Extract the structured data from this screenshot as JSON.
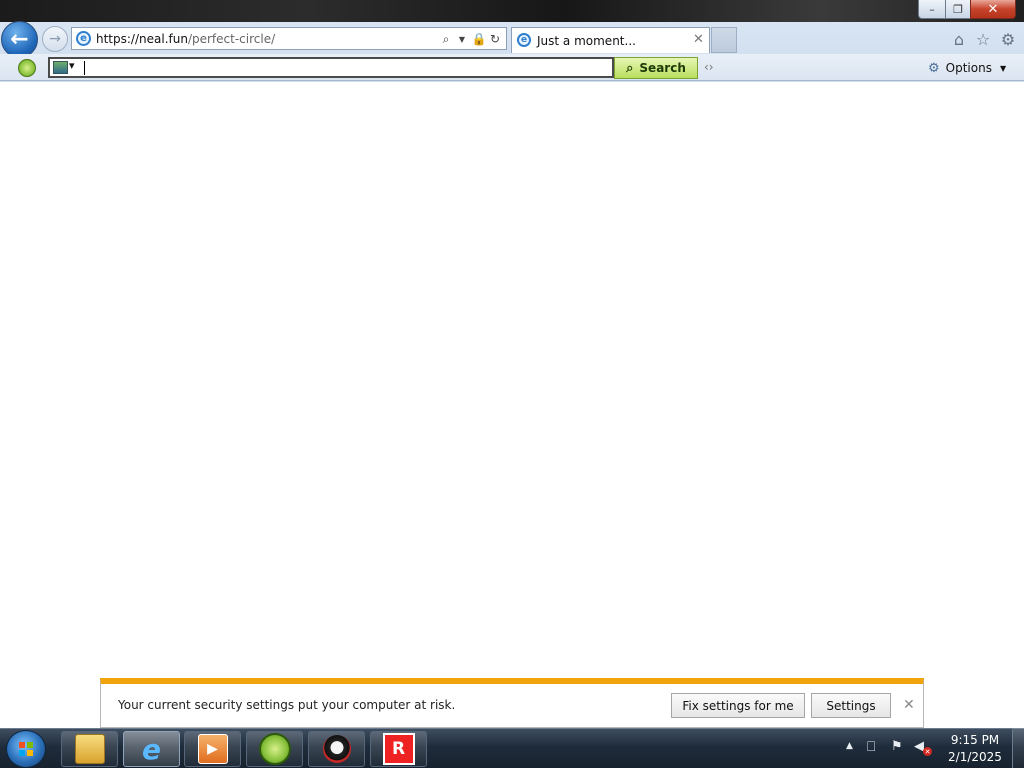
{
  "window": {
    "minimize_glyph": "–",
    "maximize_glyph": "❐",
    "close_glyph": "✕"
  },
  "nav": {
    "back_glyph": "←",
    "forward_glyph": "→"
  },
  "address_bar": {
    "url_host": "https://neal.fun",
    "url_path": "/perfect-circle/",
    "page_icon": "ie-icon",
    "tools": [
      "search-icon",
      "dropdown-icon",
      "lock-icon",
      "refresh-icon"
    ]
  },
  "tabs": [
    {
      "title": "Just a moment...",
      "icon": "ie-icon",
      "active": true
    }
  ],
  "command_icons": [
    "home-icon",
    "favorites-icon",
    "tools-icon"
  ],
  "toolbar": {
    "search_value": "",
    "search_button_label": "Search",
    "options_label": "Options"
  },
  "notification": {
    "message": "Your current security settings put your computer at risk.",
    "fix_button_label": "Fix settings for me",
    "settings_button_label": "Settings",
    "accent_color": "#f0a30a"
  },
  "taskbar": {
    "pinned": [
      "file-explorer",
      "internet-explorer",
      "media-player",
      "green-app",
      "character-app",
      "roblox"
    ],
    "active": "internet-explorer",
    "clock_time": "9:15 PM",
    "clock_date": "2/1/2025"
  },
  "colors": {
    "search_button": "#b9df5e",
    "back_button": "#1f66b8",
    "close_button": "#c8432b"
  }
}
